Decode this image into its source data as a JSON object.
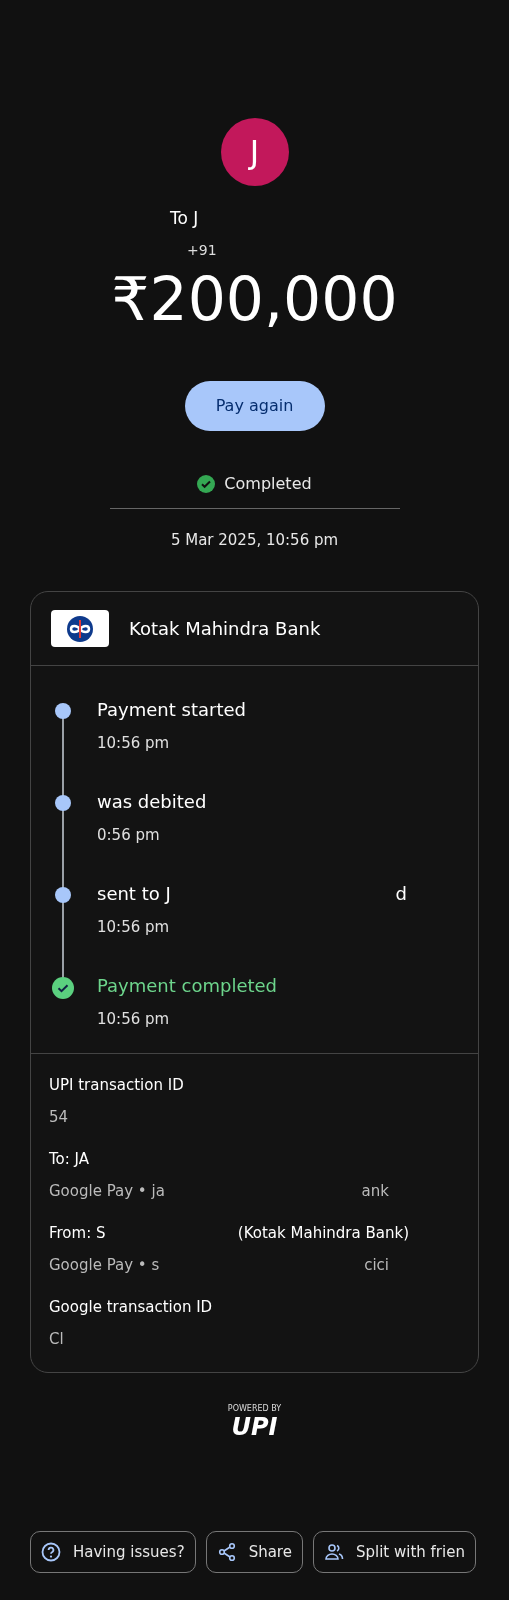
{
  "header": {
    "avatar_letter": "J",
    "recipient": "To J",
    "phone": "+91",
    "amount": "₹200,000"
  },
  "pay_again": "Pay again",
  "status": {
    "label": "Completed",
    "completed": true
  },
  "date": "5 Mar 2025, 10:56 pm",
  "bank": {
    "name": "Kotak Mahindra Bank"
  },
  "timeline": [
    {
      "title": "Payment started",
      "time": "10:56 pm",
      "done": false
    },
    {
      "title": "was debited",
      "time": "0:56 pm",
      "done": false
    },
    {
      "title": "sent to J",
      "tail": "d",
      "time": "10:56 pm",
      "done": false
    },
    {
      "title": "Payment completed",
      "time": "10:56 pm",
      "done": true
    }
  ],
  "details": [
    {
      "label": "UPI transaction ID",
      "value": "54"
    },
    {
      "label": "To: JA",
      "value": "Google Pay • ja",
      "value_tail": "ank"
    },
    {
      "label": "From: S",
      "label_tail": "(Kotak Mahindra Bank)",
      "value": "Google Pay • s",
      "value_tail": "cici"
    },
    {
      "label": "Google transaction ID",
      "value": "Cl"
    }
  ],
  "upi_logo": {
    "caption": "POWERED BY",
    "mark": "UPI"
  },
  "actions": [
    {
      "kind": "help",
      "label": "Having issues?"
    },
    {
      "kind": "share",
      "label": "Share"
    },
    {
      "kind": "split",
      "label": "Split with frien"
    }
  ]
}
